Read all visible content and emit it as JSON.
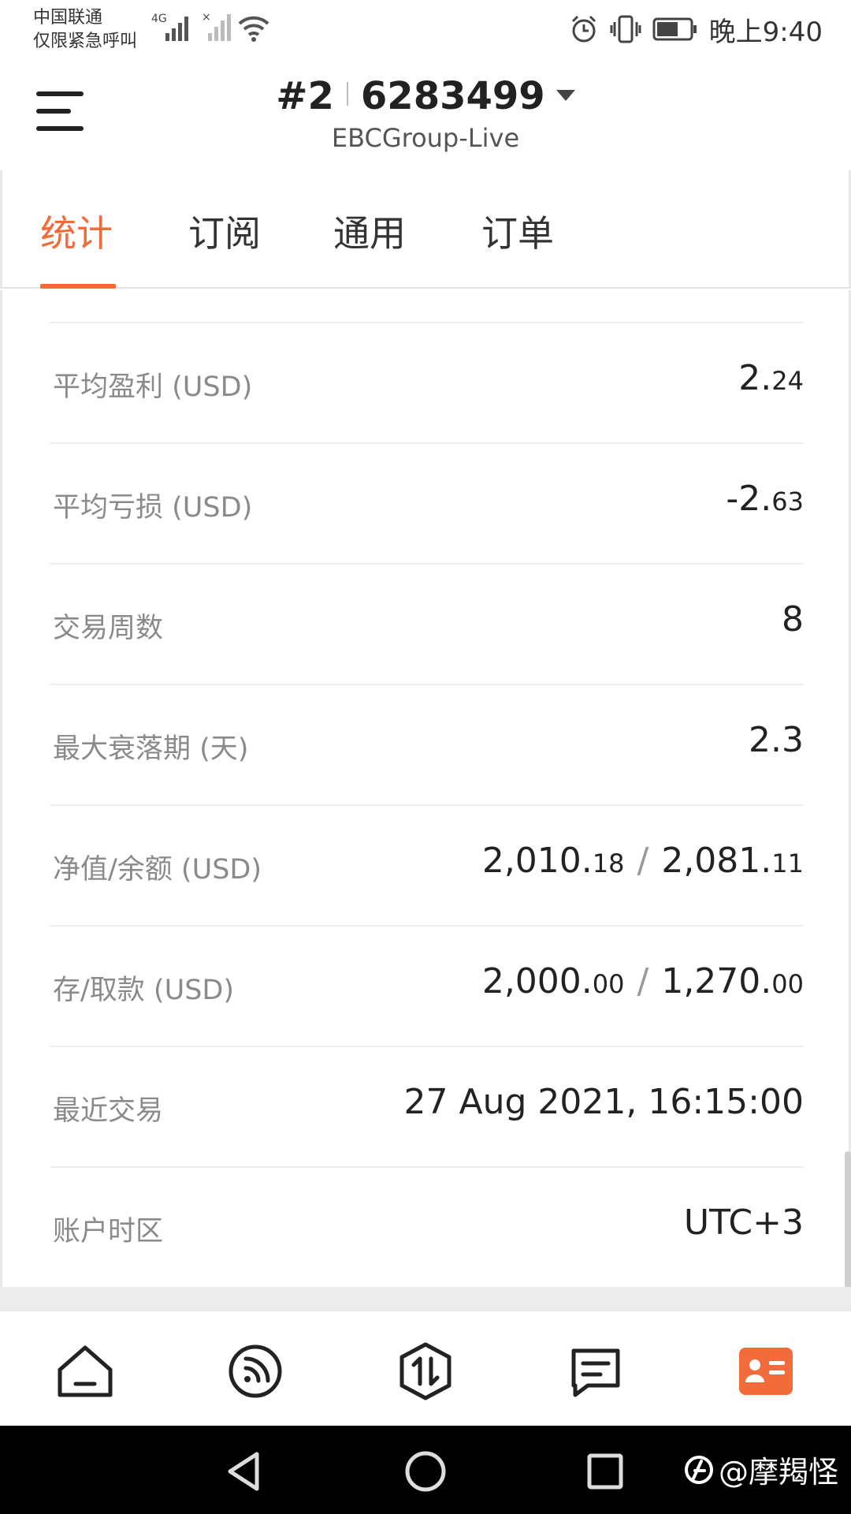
{
  "status_bar": {
    "carrier": "中国联通",
    "carrier_note": "仅限紧急呼叫",
    "network": "4G",
    "time": "晚上9:40"
  },
  "header": {
    "account_index": "#2",
    "account_number": "6283499",
    "server": "EBCGroup-Live"
  },
  "tabs": [
    {
      "label": "统计",
      "active": true
    },
    {
      "label": "订阅",
      "active": false
    },
    {
      "label": "通用",
      "active": false
    },
    {
      "label": "订单",
      "active": false
    }
  ],
  "stats": [
    {
      "label": "平均盈利 (USD)",
      "value_main": "2.",
      "value_small": "24"
    },
    {
      "label": "平均亏损 (USD)",
      "value_main": "-2.",
      "value_small": "63"
    },
    {
      "label": "交易周数",
      "value_main": "8"
    },
    {
      "label": "最大衰落期 (天)",
      "value_main": "2.3"
    },
    {
      "label": "净值/余额 (USD)",
      "value_a_main": "2,010.",
      "value_a_small": "18",
      "separator": "/",
      "value_b_main": "2,081.",
      "value_b_small": "11"
    },
    {
      "label": "存/取款 (USD)",
      "value_a_main": "2,000.",
      "value_a_small": "00",
      "separator": "/",
      "value_b_main": "1,270.",
      "value_b_small": "00"
    },
    {
      "label": "最近交易",
      "value_main": "27 Aug 2021, 16:15:00"
    },
    {
      "label": "账户时区",
      "value_main": "UTC+3"
    }
  ],
  "bottom_nav": [
    {
      "icon": "home-icon",
      "active": false
    },
    {
      "icon": "signals-feed-icon",
      "active": false
    },
    {
      "icon": "trade-icon",
      "active": false
    },
    {
      "icon": "messages-icon",
      "active": false
    },
    {
      "icon": "account-card-icon",
      "active": true
    }
  ],
  "watermark": "@摩羯怪",
  "colors": {
    "accent": "#f06a3a",
    "text": "#222222",
    "label": "#8a8a8a"
  }
}
